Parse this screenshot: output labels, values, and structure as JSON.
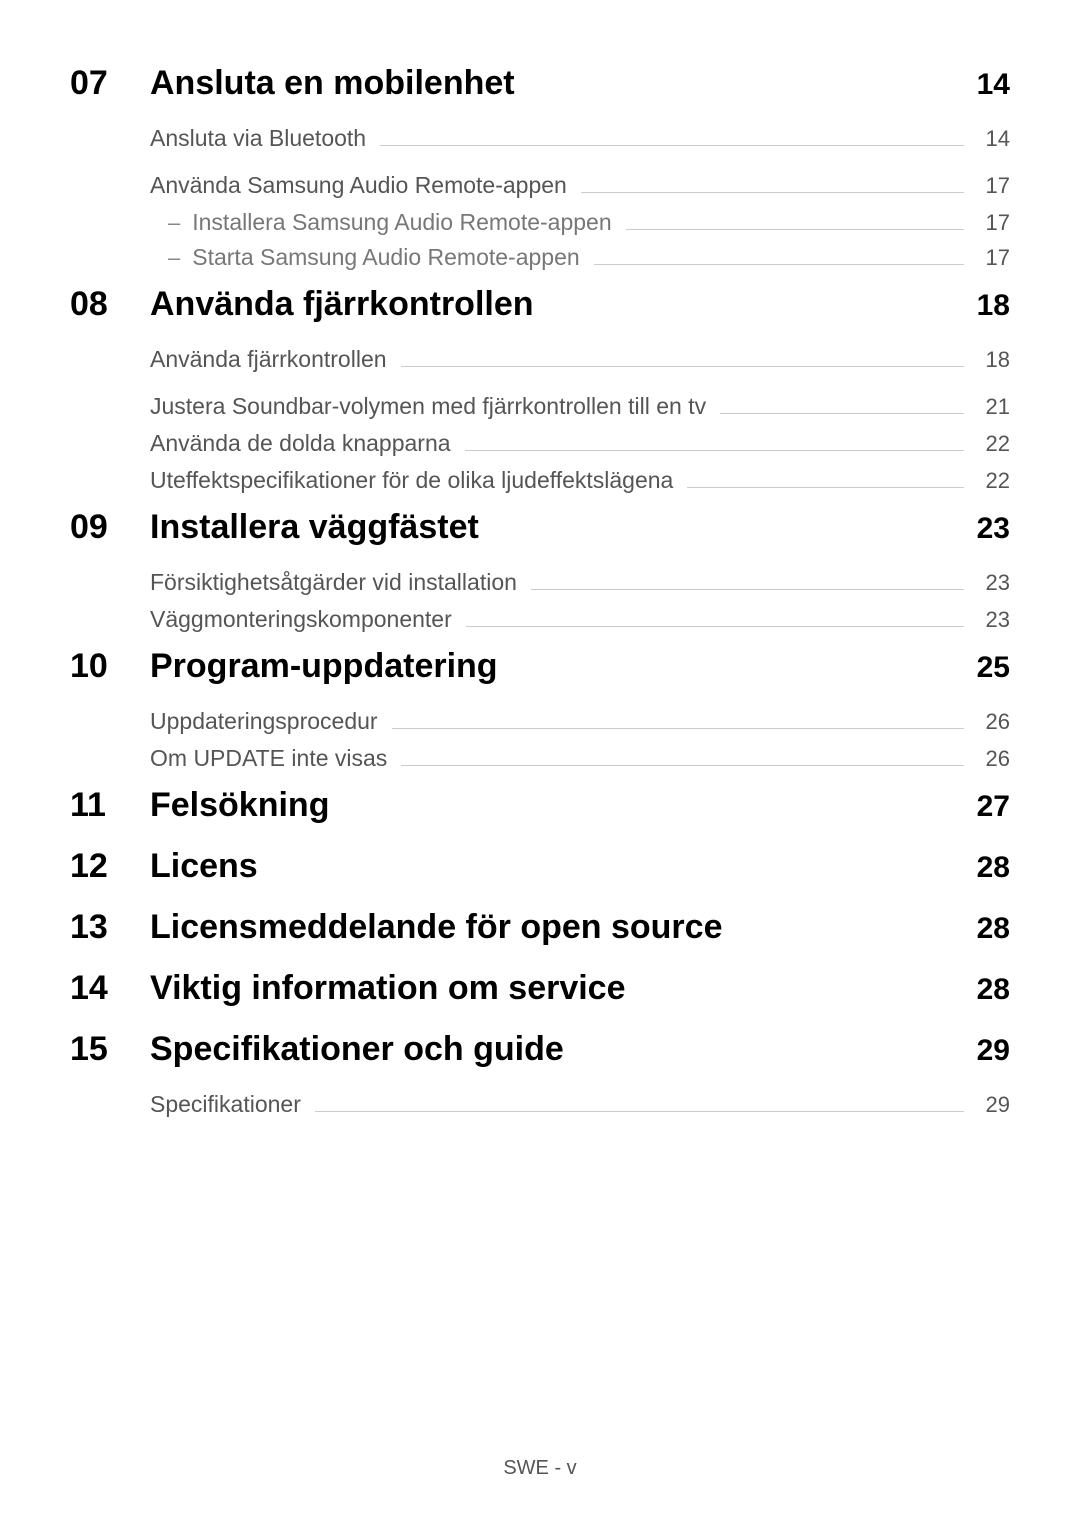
{
  "sections": [
    {
      "number": "07",
      "title": "Ansluta en mobilenhet",
      "page": "14",
      "subs": [
        {
          "title": "Ansluta via Bluetooth",
          "page": "14",
          "gap_after": true
        },
        {
          "title": "Använda Samsung Audio Remote-appen",
          "page": "17",
          "subs": [
            {
              "title": "Installera Samsung Audio Remote-appen",
              "page": "17"
            },
            {
              "title": "Starta Samsung Audio Remote-appen",
              "page": "17"
            }
          ]
        }
      ]
    },
    {
      "number": "08",
      "title": "Använda fjärrkontrollen",
      "page": "18",
      "subs": [
        {
          "title": "Använda fjärrkontrollen",
          "page": "18",
          "gap_after": true
        },
        {
          "title": "Justera Soundbar-volymen med fjärrkontrollen till en tv",
          "page": "21"
        },
        {
          "title": "Använda de dolda knapparna",
          "page": "22"
        },
        {
          "title": "Uteffektspecifikationer för de olika ljudeffektslägena",
          "page": "22"
        }
      ]
    },
    {
      "number": "09",
      "title": "Installera väggfästet",
      "page": "23",
      "subs": [
        {
          "title": "Försiktighetsåtgärder vid installation",
          "page": "23"
        },
        {
          "title": "Väggmonteringskomponenter",
          "page": "23"
        }
      ]
    },
    {
      "number": "10",
      "title": "Program-uppdatering",
      "page": "25",
      "subs": [
        {
          "title": "Uppdateringsprocedur",
          "page": "26"
        },
        {
          "title": "Om UPDATE inte visas",
          "page": "26"
        }
      ]
    },
    {
      "number": "11",
      "title": "Felsökning",
      "page": "27",
      "subs": []
    },
    {
      "number": "12",
      "title": "Licens",
      "page": "28",
      "subs": []
    },
    {
      "number": "13",
      "title": "Licensmeddelande för open source",
      "page": "28",
      "subs": []
    },
    {
      "number": "14",
      "title": "Viktig information om service",
      "page": "28",
      "subs": []
    },
    {
      "number": "15",
      "title": "Specifikationer och guide",
      "page": "29",
      "subs": [
        {
          "title": "Specifikationer",
          "page": "29"
        }
      ]
    }
  ],
  "footer": "SWE - v"
}
